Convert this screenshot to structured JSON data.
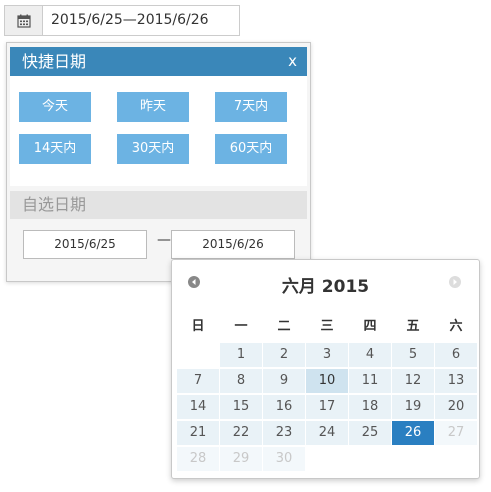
{
  "range_input": {
    "value": "2015/6/25—2015/6/26",
    "icon": "calendar-icon"
  },
  "quick_panel": {
    "title": "快捷日期",
    "close_label": "x",
    "buttons": [
      "今天",
      "昨天",
      "7天内",
      "14天内",
      "30天内",
      "60天内"
    ]
  },
  "custom_panel": {
    "title": "自选日期",
    "start_date": "2015/6/25",
    "separator": "—",
    "end_date": "2015/6/26"
  },
  "calendar": {
    "month_label": "六月",
    "year_label": "2015",
    "weekdays": [
      "日",
      "一",
      "二",
      "三",
      "四",
      "五",
      "六"
    ],
    "days": [
      "1",
      "2",
      "3",
      "4",
      "5",
      "6",
      "7",
      "8",
      "9",
      "10",
      "11",
      "12",
      "13",
      "14",
      "15",
      "16",
      "17",
      "18",
      "19",
      "20",
      "21",
      "22",
      "23",
      "24",
      "25",
      "26",
      "27",
      "28",
      "29",
      "30"
    ],
    "first_weekday_index": 1,
    "today": "10",
    "selected": "26",
    "disabled_from": "27",
    "colors": {
      "selected": "#2a7fc1",
      "header": "#3a87b9",
      "quick_button": "#6cb3e3"
    }
  }
}
